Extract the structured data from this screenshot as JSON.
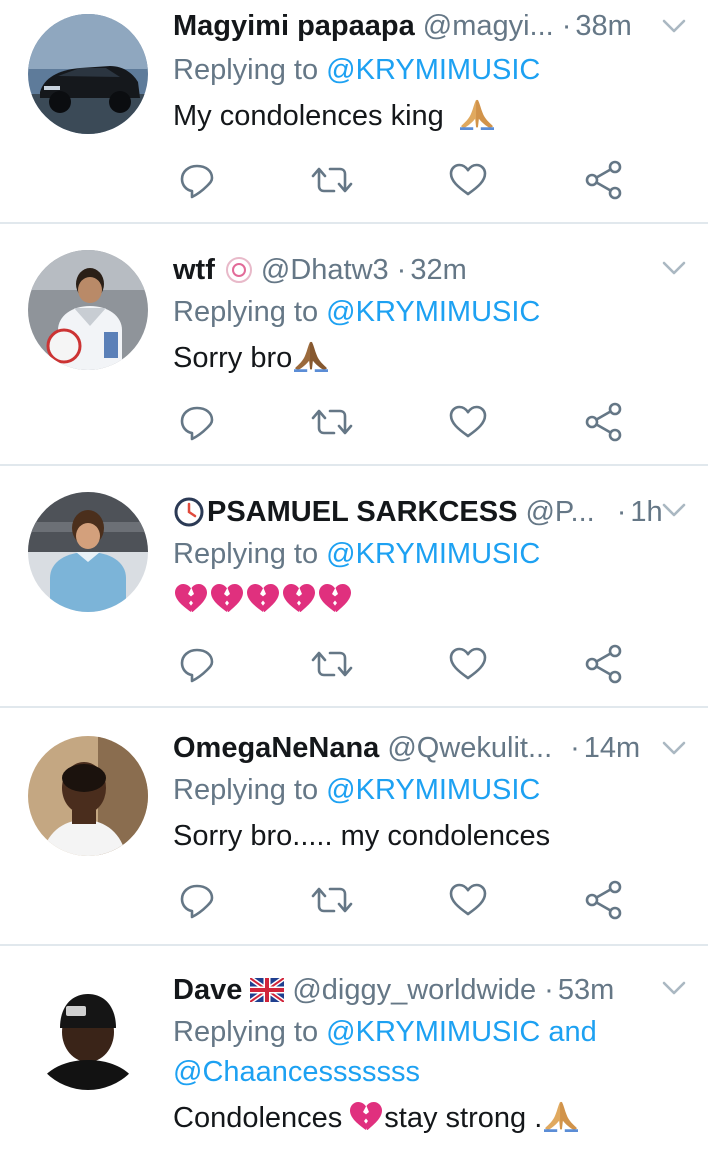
{
  "colors": {
    "link": "#1da1f2",
    "secondary": "#657786",
    "divider": "#e1e8ed"
  },
  "tweets": [
    {
      "name": "Magyimi papaapa",
      "handle": "@magyi...",
      "dot": "·",
      "time": "38m",
      "replying_prefix": "Replying to",
      "replying_to": "@KRYMIMUSIC",
      "text": "My condolences king",
      "avatar": "black-suv-avatar"
    },
    {
      "name": "wtf",
      "handle": "@Dhatw3",
      "dot": "·",
      "time": "32m",
      "replying_prefix": "Replying to",
      "replying_to": "@KRYMIMUSIC",
      "text": "Sorry bro",
      "avatar": "footballer-avatar"
    },
    {
      "name": "PSAMUEL SARKCESS",
      "handle": "@P...",
      "dot": "·",
      "time": "1h",
      "replying_prefix": "Replying to",
      "replying_to": "@KRYMIMUSIC",
      "text": "",
      "broken_hearts": 5,
      "avatar": "vintage-footballer-avatar"
    },
    {
      "name": "OmegaNeNana",
      "handle": "@Qwekulit...",
      "dot": "·",
      "time": "14m",
      "replying_prefix": "Replying to",
      "replying_to": "@KRYMIMUSIC",
      "text": "Sorry bro..... my condolences",
      "avatar": "man-selfie-avatar"
    },
    {
      "name": "Dave",
      "handle": "@diggy_worldwide",
      "dot": "·",
      "time": "53m",
      "replying_prefix": "Replying to",
      "replying_to": "@KRYMIMUSIC",
      "replying_and": "and",
      "replying_to_2": "@Chaancesssssss",
      "text_a": "Condolences",
      "text_b": "stay strong .",
      "avatar": "beanie-man-avatar"
    }
  ]
}
